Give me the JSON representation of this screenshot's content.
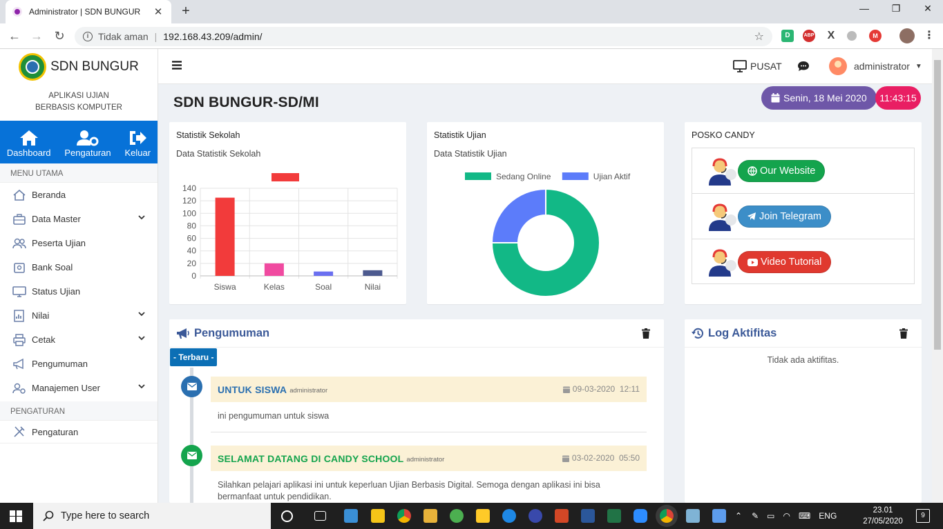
{
  "browser": {
    "tab_title": "Administrator | SDN BUNGUR",
    "address_prefix": "Tidak aman",
    "url": "192.168.43.209/admin/"
  },
  "sidebar": {
    "brand_name": "SDN BUNGUR",
    "brand_sub_line1": "APLIKASI UJIAN",
    "brand_sub_line2": "BERBASIS KOMPUTER",
    "quick": {
      "dashboard": "Dashboard",
      "pengaturan": "Pengaturan",
      "keluar": "Keluar"
    },
    "menu_utama": "MENU UTAMA",
    "items": [
      {
        "label": "Beranda"
      },
      {
        "label": "Data Master"
      },
      {
        "label": "Peserta Ujian"
      },
      {
        "label": "Bank Soal"
      },
      {
        "label": "Status Ujian"
      },
      {
        "label": "Nilai"
      },
      {
        "label": "Cetak"
      },
      {
        "label": "Pengumuman"
      },
      {
        "label": "Manajemen User"
      }
    ],
    "pengaturan_head": "PENGATURAN",
    "pengaturan_item": "Pengaturan"
  },
  "topnav": {
    "pusat": "PUSAT",
    "username": "administrator"
  },
  "header": {
    "page_title": "SDN BUNGUR-SD/MI",
    "date": "Senin, 18 Mei 2020",
    "time": "11:43:15"
  },
  "stat_sekolah": {
    "title": "Statistik Sekolah",
    "subtitle": "Data Statistik Sekolah"
  },
  "stat_ujian": {
    "title": "Statistik Ujian",
    "subtitle": "Data Statistik Ujian"
  },
  "chart_data": [
    {
      "type": "bar",
      "categories": [
        "Siswa",
        "Kelas",
        "Soal",
        "Nilai"
      ],
      "values": [
        125,
        20,
        7,
        9
      ],
      "colors": [
        "#f23b3b",
        "#f04aa0",
        "#6a6ff0",
        "#4d5a8f"
      ],
      "ylim": [
        0,
        140
      ],
      "yticks": [
        0,
        20,
        40,
        60,
        80,
        100,
        120,
        140
      ],
      "legend_color": "#f23b3b"
    },
    {
      "type": "pie",
      "labels": [
        "Sedang Online",
        "Ujian Aktif"
      ],
      "values": [
        75,
        25
      ],
      "colors": [
        "#12b886",
        "#5c7cfa"
      ],
      "legend_placement": "top"
    }
  ],
  "posko": {
    "title": "POSKO CANDY",
    "buttons": [
      {
        "label": "Our Website",
        "color": "#14a44d"
      },
      {
        "label": "Join Telegram",
        "color": "#3c8ec8"
      },
      {
        "label": "Video Tutorial",
        "color": "#e0392f"
      }
    ]
  },
  "pengumuman": {
    "title": "Pengumuman",
    "badge": "- Terbaru -",
    "items": [
      {
        "title": "UNTUK SISWA",
        "by": "administrator",
        "date": "09-03-2020",
        "time": "12:11",
        "body": "ini pengumuman untuk siswa",
        "color": "#2a6fb0"
      },
      {
        "title": "SELAMAT DATANG DI CANDY SCHOOL",
        "by": "administrator",
        "date": "03-02-2020",
        "time": "05:50",
        "body": "Silahkan pelajari aplikasi ini untuk keperluan Ujian Berbasis Digital. Semoga dengan aplikasi ini bisa bermanfaat untuk pendidikan.",
        "color": "#14a44d"
      }
    ]
  },
  "log": {
    "title": "Log Aktifitas",
    "empty": "Tidak ada aktifitas."
  },
  "taskbar": {
    "search_placeholder": "Type here to search",
    "lang": "ENG",
    "time": "23.01",
    "date": "27/05/2020",
    "notif_count": "9"
  }
}
